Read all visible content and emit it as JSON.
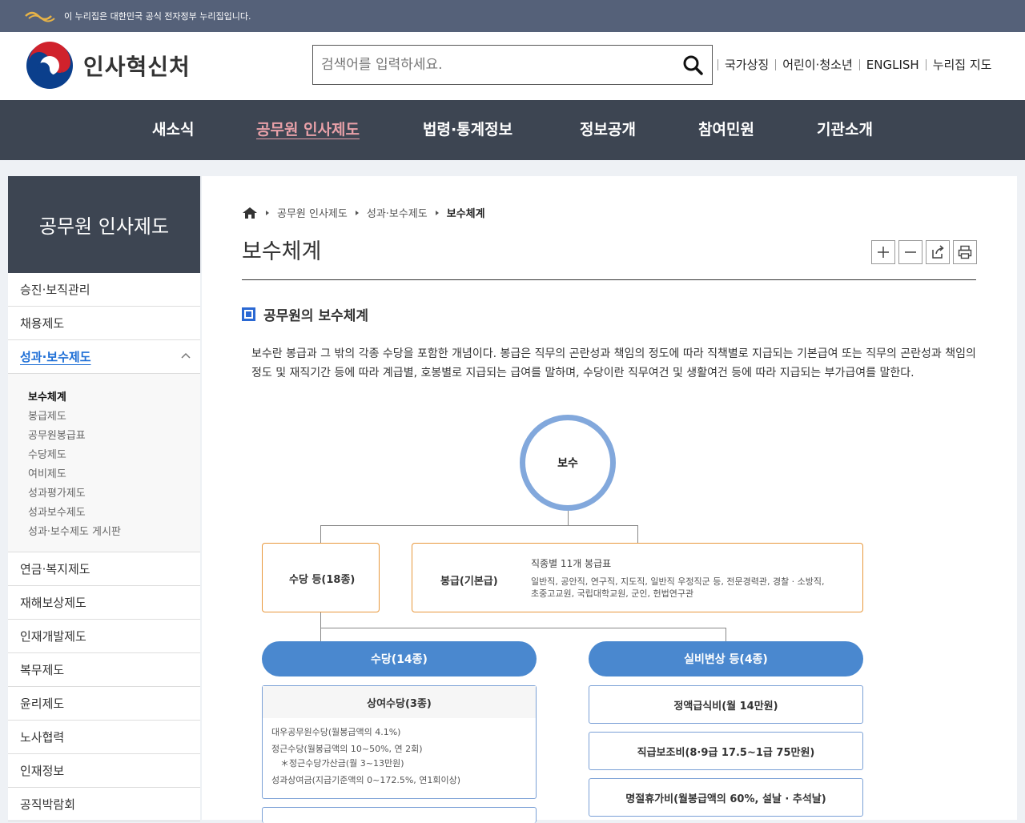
{
  "gov_banner": {
    "text": "이 누리집은 대한민국 공식 전자정부 누리집입니다."
  },
  "header": {
    "logo_text": "인사혁신처",
    "search_placeholder": "검색어를 입력하세요.",
    "utils": [
      "국가상징",
      "어린이·청소년",
      "ENGLISH",
      "누리집 지도"
    ]
  },
  "gnb": {
    "items": [
      {
        "label": "새소식"
      },
      {
        "label": "공무원 인사제도",
        "active": true
      },
      {
        "label": "법령·통계정보"
      },
      {
        "label": "정보공개"
      },
      {
        "label": "참여민원"
      },
      {
        "label": "기관소개"
      }
    ]
  },
  "sidebar": {
    "title": "공무원 인사제도",
    "items": [
      {
        "label": "승진·보직관리"
      },
      {
        "label": "채용제도"
      },
      {
        "label": "성과·보수제도",
        "active": true
      },
      {
        "label": "연금·복지제도"
      },
      {
        "label": "재해보상제도"
      },
      {
        "label": "인재개발제도"
      },
      {
        "label": "복무제도"
      },
      {
        "label": "윤리제도"
      },
      {
        "label": "노사협력"
      },
      {
        "label": "인재정보"
      },
      {
        "label": "공직박람회"
      }
    ],
    "subitems": [
      {
        "label": "보수체계",
        "active": true
      },
      {
        "label": "봉급제도"
      },
      {
        "label": "공무원봉급표"
      },
      {
        "label": "수당제도"
      },
      {
        "label": "여비제도"
      },
      {
        "label": "성과평가제도"
      },
      {
        "label": "성과보수제도"
      },
      {
        "label": "성과·보수제도 게시판"
      }
    ]
  },
  "breadcrumb": [
    "공무원 인사제도",
    "성과·보수제도",
    "보수체계"
  ],
  "page": {
    "title": "보수체계",
    "section_title": "공무원의 보수체계",
    "description": "보수란 봉급과 그 밖의 각종 수당을 포함한 개념이다. 봉급은 직무의 곤란성과 책임의 정도에 따라 직책별로 지급되는 기본급여 또는 직무의 곤란성과 책임의 정도 및 재직기간 등에 따라 계급별, 호봉별로 지급되는 급여를 말하며, 수당이란 직무여건 및 생활여건 등에 따라 지급되는 부가급여를 말한다."
  },
  "diagram": {
    "root": "보수",
    "allowance_box": "수당 등(18종)",
    "salary_box": {
      "label": "봉급(기본급)",
      "title": "직종별 11개 봉급표",
      "detail_1": "일반직, 공안직, 연구직, 지도직, 일반직 우정직군 등, 전문경력관, 경찰 · 소방직,",
      "detail_2": "초중고교원, 국립대학교원, 군인, 헌법연구관"
    },
    "left_pill": "수당(14종)",
    "right_pill": "실비변상 등(4종)",
    "bonus_box": {
      "title": "상여수당(3종)",
      "lines": [
        "대우공무원수당(월봉급액의 4.1%)",
        "정근수당(월봉급액의 10~50%, 연 2회)",
        "＊정근수당가산금(월 3~13만원)",
        "성과상여금(지급기준액의 0~172.5%, 연1회이상)"
      ]
    },
    "right_boxes": [
      "정액급식비(월 14만원)",
      "직급보조비(8·9급 17.5~1급 75만원)",
      "명절휴가비(월봉급액의 60%, 설날 · 추석날)"
    ]
  }
}
